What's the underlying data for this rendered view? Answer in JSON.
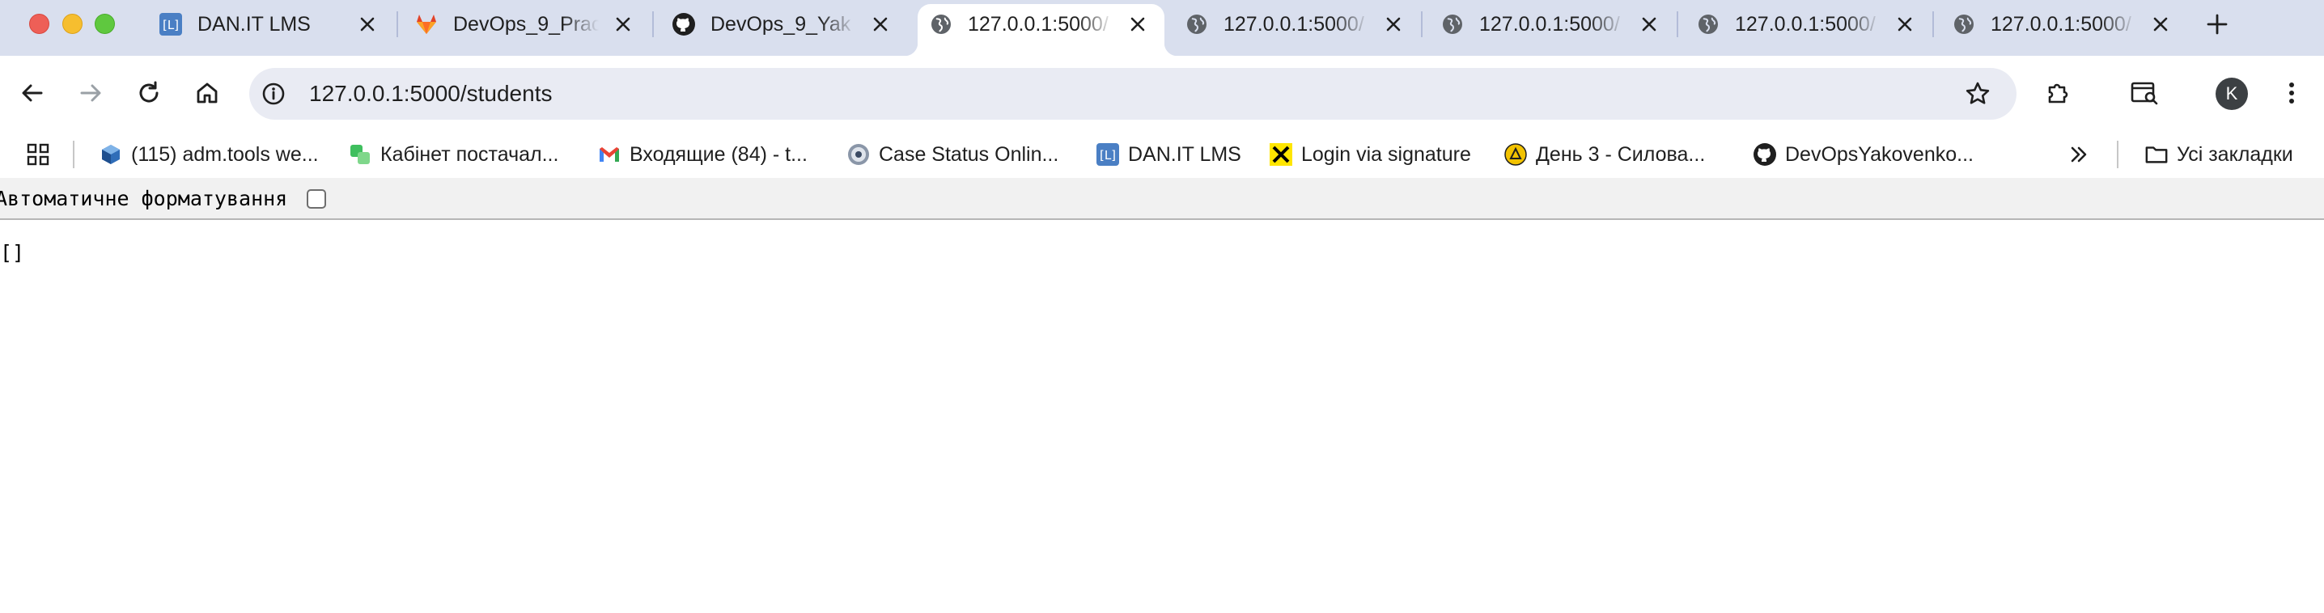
{
  "tabs": [
    {
      "title": "DAN.IT LMS",
      "icon": "dan-it-lms-icon",
      "active": false
    },
    {
      "title": "DevOps_9_Prac",
      "icon": "gitlab-icon",
      "active": false
    },
    {
      "title": "DevOps_9_Yak",
      "icon": "github-icon",
      "active": false
    },
    {
      "title": "127.0.0.1:5000/",
      "icon": "globe-icon",
      "active": true
    },
    {
      "title": "127.0.0.1:5000/",
      "icon": "globe-icon",
      "active": false
    },
    {
      "title": "127.0.0.1:5000/",
      "icon": "globe-icon",
      "active": false
    },
    {
      "title": "127.0.0.1:5000/",
      "icon": "globe-icon",
      "active": false
    },
    {
      "title": "127.0.0.1:5000/",
      "icon": "globe-icon",
      "active": false
    }
  ],
  "address_bar": {
    "url": "127.0.0.1:5000/students"
  },
  "profile": {
    "initial": "K"
  },
  "bookmarks": [
    {
      "label": "(115) adm.tools we...",
      "icon": "adm-tools-icon"
    },
    {
      "label": "Кабінет постачал...",
      "icon": "cabinet-icon"
    },
    {
      "label": "Входящие (84) - t...",
      "icon": "gmail-icon"
    },
    {
      "label": "Case Status Onlin...",
      "icon": "uscis-seal-icon"
    },
    {
      "label": "DAN.IT LMS",
      "icon": "dan-it-lms-icon"
    },
    {
      "label": "Login via signature",
      "icon": "raiffeisen-icon"
    },
    {
      "label": "День 3 - Силова...",
      "icon": "training-icon"
    },
    {
      "label": "DevOpsYakovenko...",
      "icon": "github-icon"
    }
  ],
  "all_bookmarks_label": "Усі закладки",
  "pretty_print": {
    "label": "Автоматичне форматування",
    "checked": false
  },
  "body_text": "[]",
  "colors": {
    "tabstrip_bg": "#d9dfee",
    "omnibox_bg": "#e9ebf3",
    "pretty_bar_bg": "#f1f1f1"
  }
}
